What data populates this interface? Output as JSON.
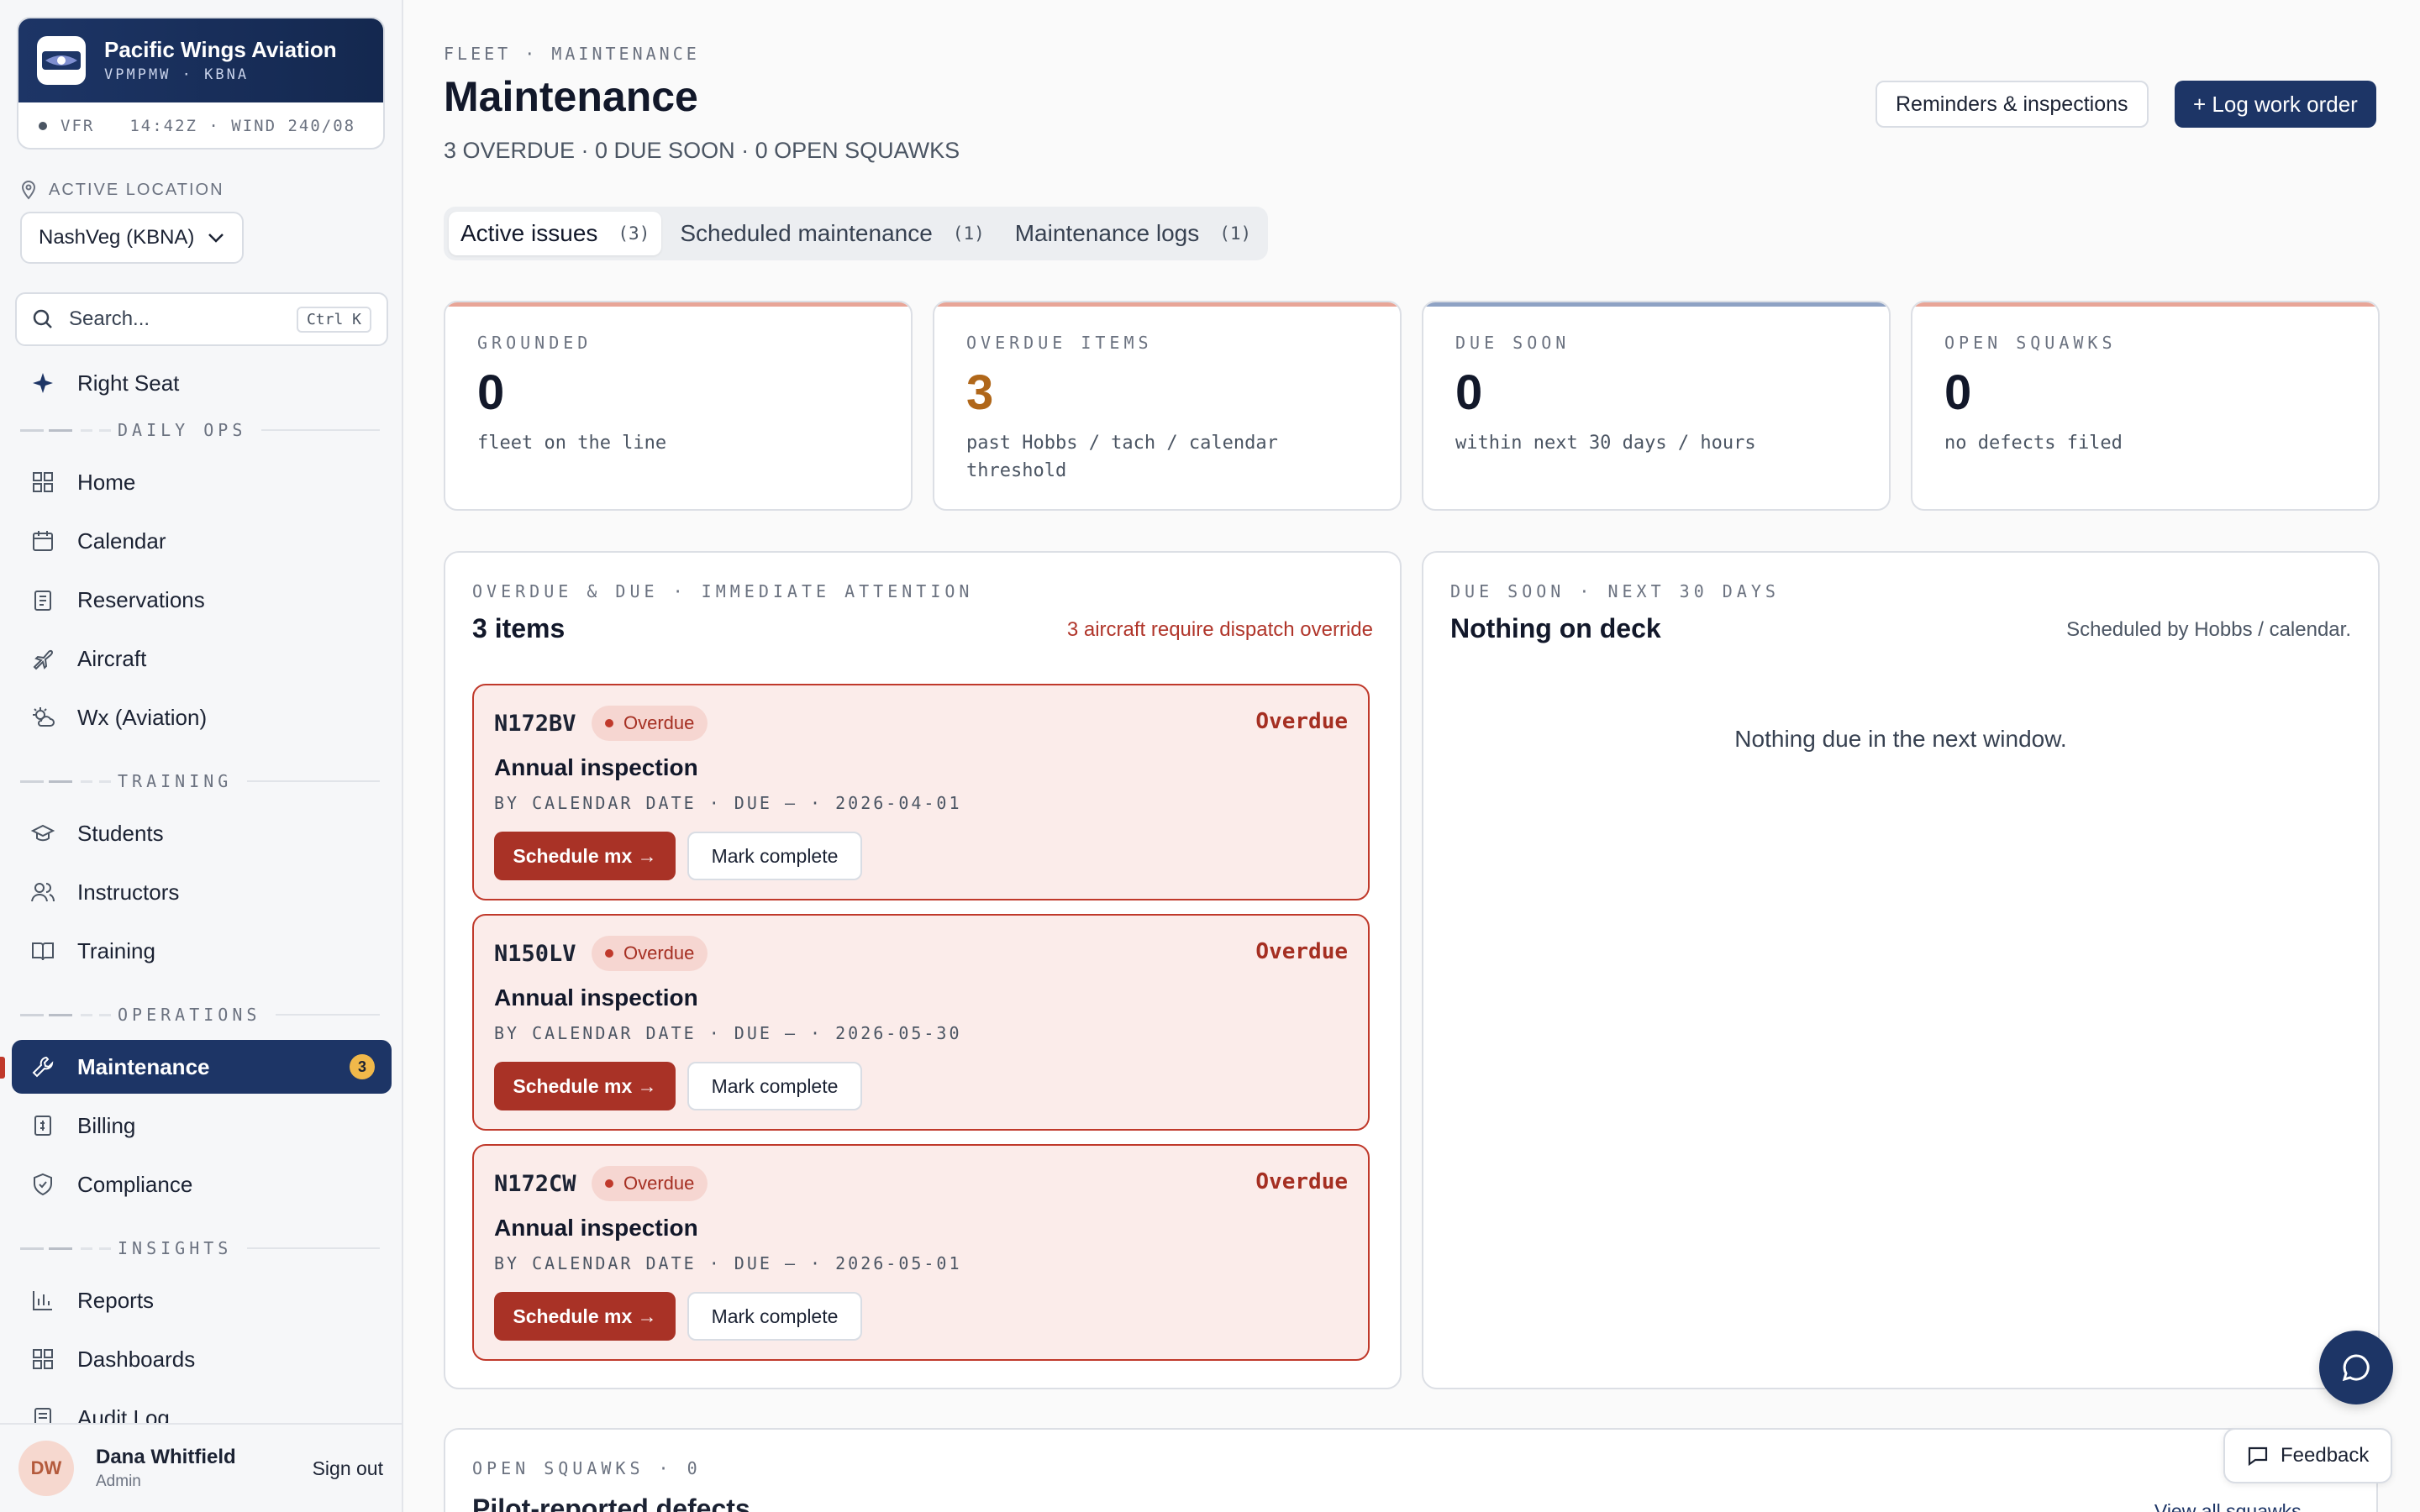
{
  "org": {
    "name": "Pacific Wings Aviation",
    "sub": "VPMPMW · KBNA",
    "wx": "VFR",
    "time_wind": "14:42Z · WIND 240/08"
  },
  "location": {
    "label": "ACTIVE LOCATION",
    "value": "NashVeg (KBNA)"
  },
  "search": {
    "placeholder": "Search...",
    "shortcut": "Ctrl K"
  },
  "nav": {
    "right_seat": "Right Seat",
    "daily_ops_header": "DAILY OPS",
    "home": "Home",
    "calendar": "Calendar",
    "reservations": "Reservations",
    "aircraft": "Aircraft",
    "wx": "Wx (Aviation)",
    "training_header": "TRAINING",
    "students": "Students",
    "instructors": "Instructors",
    "training": "Training",
    "operations_header": "OPERATIONS",
    "maintenance": "Maintenance",
    "maintenance_badge": "3",
    "billing": "Billing",
    "compliance": "Compliance",
    "insights_header": "INSIGHTS",
    "reports": "Reports",
    "dashboards": "Dashboards",
    "audit_log": "Audit Log"
  },
  "user": {
    "initials": "DW",
    "name": "Dana Whitfield",
    "role": "Admin",
    "signout": "Sign out"
  },
  "header": {
    "breadcrumb": "FLEET · MAINTENANCE",
    "title": "Maintenance",
    "subtitle": "3 OVERDUE · 0 DUE SOON · 0 OPEN SQUAWKS",
    "reminders_button": "Reminders & inspections",
    "log_button": "+ Log work order"
  },
  "tabs": [
    {
      "label": "Active issues",
      "count": "(3)"
    },
    {
      "label": "Scheduled maintenance",
      "count": "(1)"
    },
    {
      "label": "Maintenance logs",
      "count": "(1)"
    }
  ],
  "stats": [
    {
      "label": "GROUNDED",
      "value": "0",
      "desc": "fleet on the line",
      "accent": "#e8a597",
      "value_color": "#12182a"
    },
    {
      "label": "OVERDUE ITEMS",
      "value": "3",
      "desc": "past Hobbs / tach / calendar threshold",
      "accent": "#e8a597",
      "value_color": "#b0671a"
    },
    {
      "label": "DUE SOON",
      "value": "0",
      "desc": "within next 30 days / hours",
      "accent": "#8ea2c4",
      "value_color": "#12182a"
    },
    {
      "label": "OPEN SQUAWKS",
      "value": "0",
      "desc": "no defects filed",
      "accent": "#e8a597",
      "value_color": "#12182a"
    }
  ],
  "overdue_panel": {
    "label": "OVERDUE & DUE · IMMEDIATE ATTENTION",
    "title": "3 items",
    "note": "3 aircraft require dispatch override",
    "items": [
      {
        "tail": "N172BV",
        "pill": "Overdue",
        "status": "Overdue",
        "name": "Annual inspection",
        "meta": "BY CALENDAR DATE · DUE — · 2026-04-01",
        "primary": "Schedule mx →",
        "secondary": "Mark complete"
      },
      {
        "tail": "N150LV",
        "pill": "Overdue",
        "status": "Overdue",
        "name": "Annual inspection",
        "meta": "BY CALENDAR DATE · DUE — · 2026-05-30",
        "primary": "Schedule mx →",
        "secondary": "Mark complete"
      },
      {
        "tail": "N172CW",
        "pill": "Overdue",
        "status": "Overdue",
        "name": "Annual inspection",
        "meta": "BY CALENDAR DATE · DUE — · 2026-05-01",
        "primary": "Schedule mx →",
        "secondary": "Mark complete"
      }
    ]
  },
  "due_panel": {
    "label": "DUE SOON · NEXT 30 DAYS",
    "title": "Nothing on deck",
    "note": "Scheduled by Hobbs / calendar.",
    "empty": "Nothing due in the next window."
  },
  "squawks": {
    "label": "OPEN SQUAWKS · 0",
    "title": "Pilot-reported defects",
    "link": "View all squawks →"
  },
  "feedback": "Feedback",
  "colors": {
    "navy": "#1d3566",
    "danger": "#c0392b",
    "amber": "#b0671a"
  }
}
